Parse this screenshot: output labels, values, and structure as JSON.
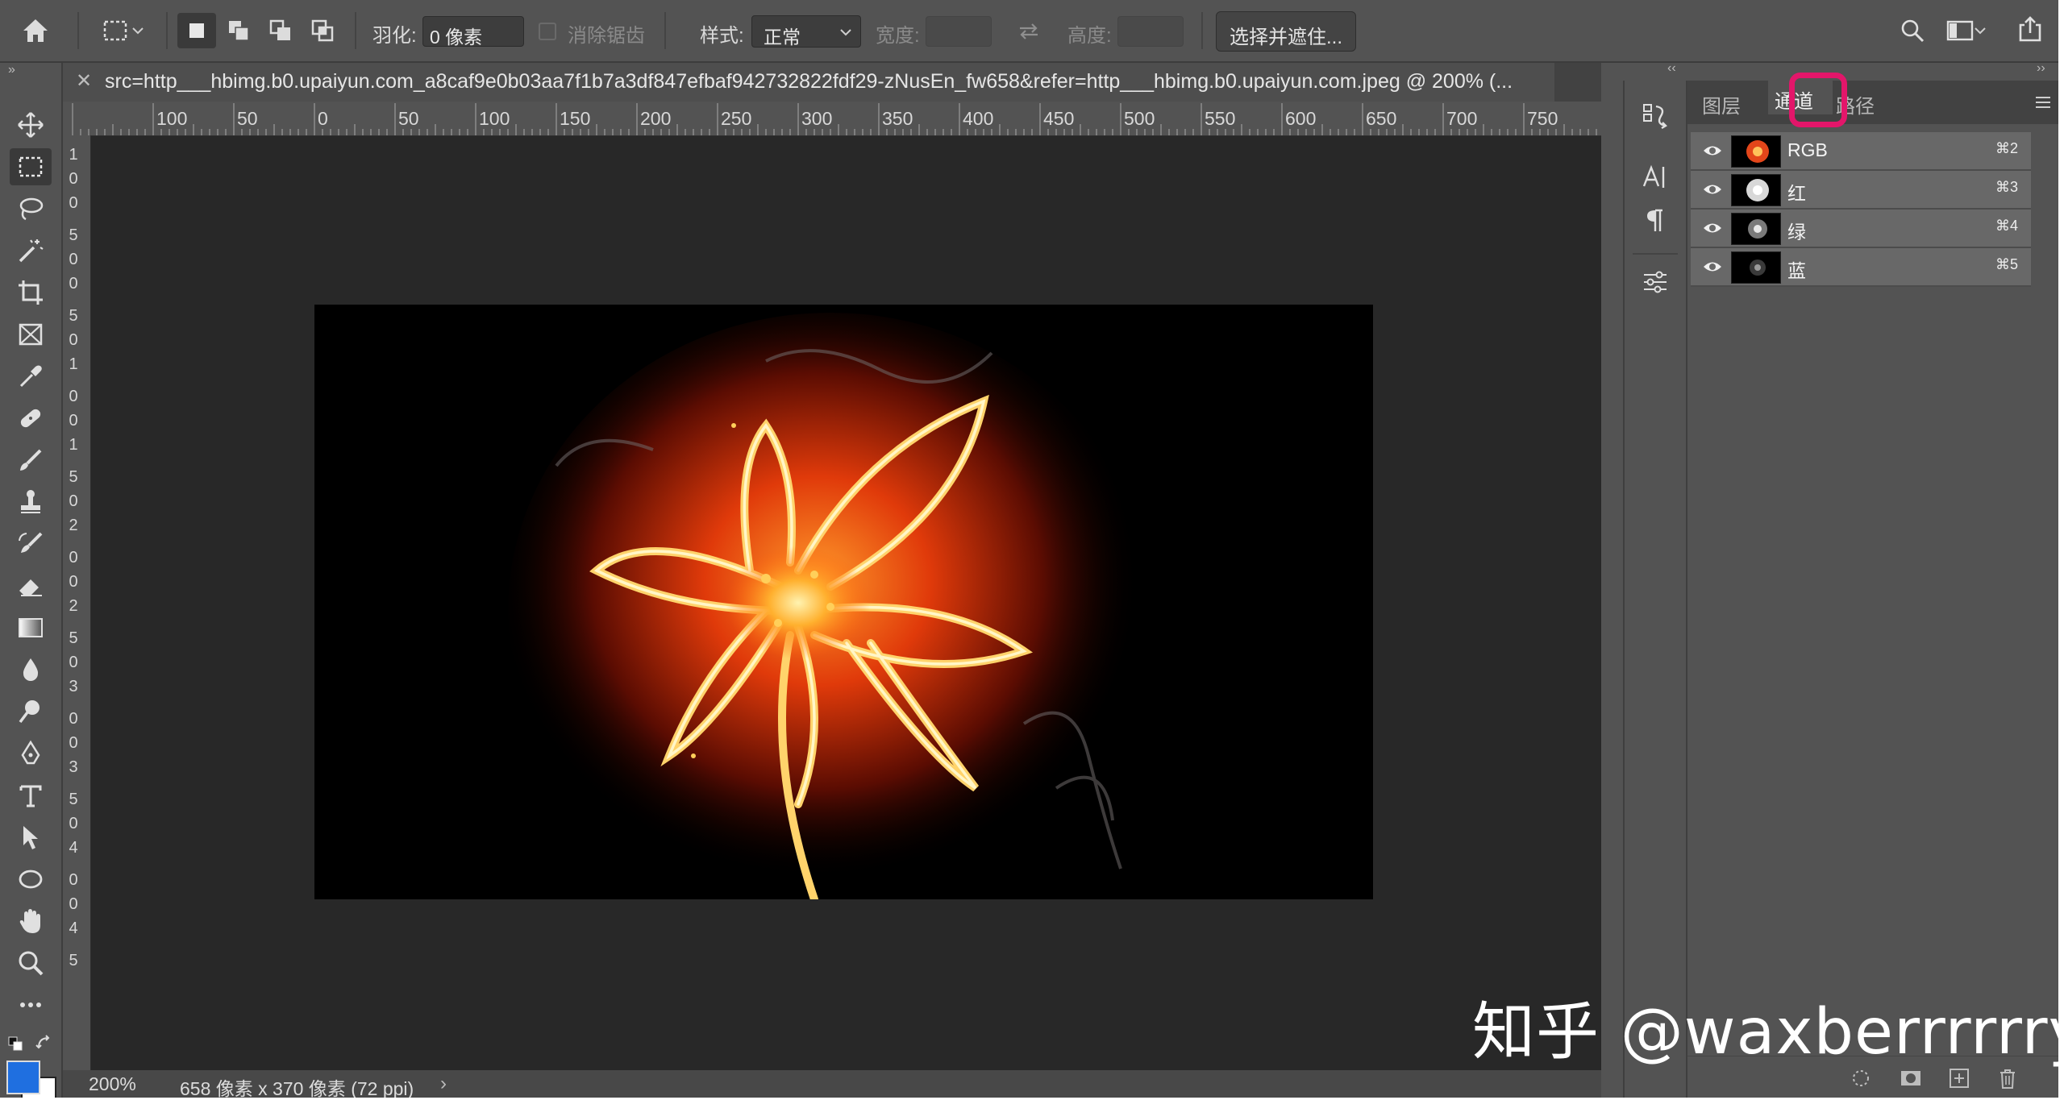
{
  "options_bar": {
    "feather_label": "羽化:",
    "feather_value": "0 像素",
    "antialias_label": "消除锯齿",
    "style_label": "样式:",
    "style_value": "正常",
    "width_label": "宽度:",
    "height_label": "高度:",
    "select_mask_button": "选择并遮住..."
  },
  "document": {
    "tab_title": "src=http___hbimg.b0.upaiyun.com_a8caf9e0b03aa7f1b7a3df847efbaf942732822fdf29-zNusEn_fw658&refer=http___hbimg.b0.upaiyun.com.jpeg @ 200% (...",
    "ruler_h": [
      "100",
      "50",
      "0",
      "50",
      "100",
      "150",
      "200",
      "250",
      "300",
      "350",
      "400",
      "450",
      "500",
      "550",
      "600",
      "650",
      "700",
      "750"
    ],
    "ruler_v": [
      "1",
      "0",
      "0",
      "5",
      "0",
      "0",
      "5",
      "0",
      "1",
      "0",
      "0",
      "1",
      "5",
      "0",
      "2",
      "0",
      "0",
      "2",
      "5",
      "0",
      "3",
      "0",
      "0",
      "3",
      "5",
      "0",
      "4",
      "0",
      "0",
      "4",
      "5"
    ],
    "status_zoom": "200%",
    "status_info": "658 像素 x 370 像素 (72 ppi)"
  },
  "panel": {
    "tabs": [
      "图层",
      "通道",
      "路径"
    ],
    "active_tab": "通道",
    "channels": [
      {
        "name": "RGB",
        "shortcut": "⌘2"
      },
      {
        "name": "红",
        "shortcut": "⌘3"
      },
      {
        "name": "绿",
        "shortcut": "⌘4"
      },
      {
        "name": "蓝",
        "shortcut": "⌘5"
      }
    ]
  },
  "watermark": "知乎 @waxberrrrrry",
  "colors": {
    "foreground": "#1f6fe0",
    "background": "#ffffff",
    "highlight": "#e3166a"
  }
}
